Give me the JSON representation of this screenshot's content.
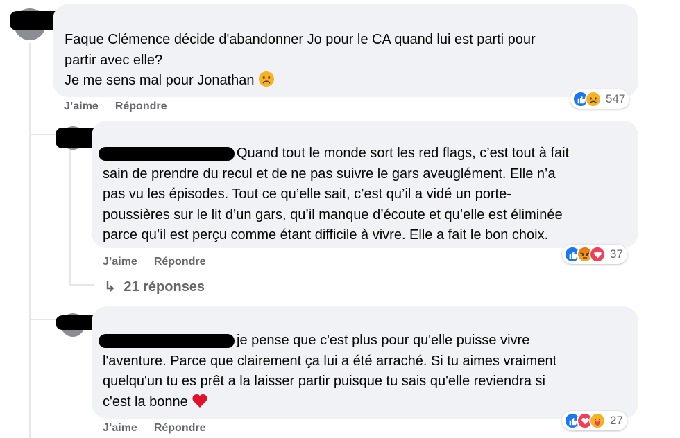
{
  "comments": [
    {
      "text_line1": "Faque Clémence décide d'abandonner Jo pour le CA quand lui est parti pour",
      "text_line2": "partir avec elle?",
      "text_line3": "Je me sens mal pour Jonathan",
      "inline_emoji": "sad-face",
      "like_label": "J’aime",
      "reply_label": "Répondre",
      "reactions": [
        "like",
        "sad"
      ],
      "reaction_count": "547"
    },
    {
      "text_lines": [
        "Quand tout le monde sort les red flags, c’est tout à fait",
        "sain de prendre du recul et de ne pas suivre le gars aveuglément. Elle n’a",
        "pas vu les épisodes. Tout ce qu’elle sait, c’est qu’il a vidé un porte-",
        "poussières sur le lit d’un gars, qu’il manque d’écoute et qu’elle est éliminée",
        "parce qu’il est perçu comme étant difficile à vivre. Elle a fait le bon choix."
      ],
      "like_label": "J’aime",
      "reply_label": "Répondre",
      "reactions": [
        "like",
        "angry",
        "love"
      ],
      "reaction_count": "37"
    },
    {
      "text_lines": [
        "je pense que c'est plus pour qu'elle puisse vivre",
        "l'aventure. Parce que clairement ça lui a été arraché. Si tu aimes vraiment",
        "quelqu'un tu es prêt a la laisser partir puisque tu sais qu'elle reviendra si",
        "c'est la bonne"
      ],
      "inline_emoji": "red-heart",
      "like_label": "J’aime",
      "reply_label": "Répondre",
      "reactions": [
        "like",
        "love",
        "care"
      ],
      "reaction_count": "27"
    }
  ],
  "view_replies": {
    "arrow": "↳",
    "label": "21 réponses"
  },
  "colors": {
    "bubble": "#f0f2f5",
    "secondary_text": "#65676b",
    "like_blue": "#1877f2",
    "love_red": "#f33e58",
    "emoji_yellow": "#f7b125"
  }
}
